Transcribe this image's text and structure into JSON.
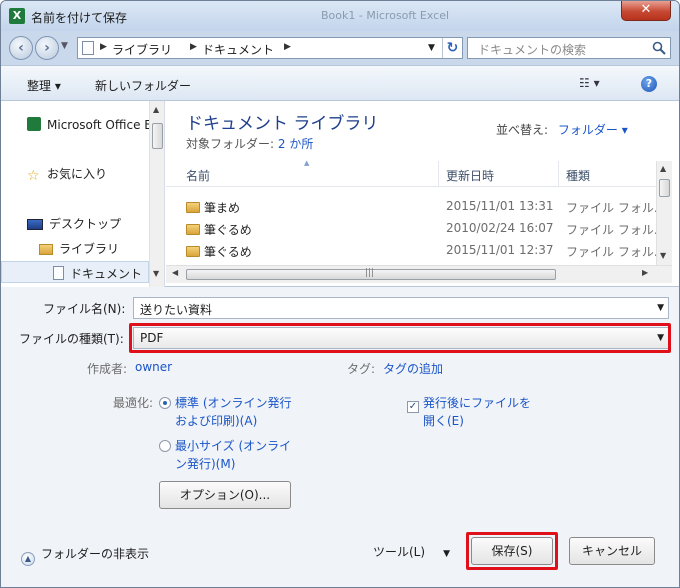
{
  "window": {
    "title": "名前を付けて保存",
    "background_title": "Book1 - Microsoft Excel",
    "close_label": "✕"
  },
  "nav": {
    "breadcrumb": [
      "ライブラリ",
      "ドキュメント"
    ],
    "search_placeholder": "ドキュメントの検索"
  },
  "toolbar": {
    "organize_label": "整理 ▾",
    "new_folder_label": "新しいフォルダー"
  },
  "navpane": {
    "items": [
      {
        "label": "Microsoft Office E",
        "icon": "excel-icon"
      },
      {
        "label": "お気に入り",
        "icon": "star-icon"
      },
      {
        "label": "デスクトップ",
        "icon": "desktop-icon"
      },
      {
        "label": "ライブラリ",
        "icon": "library-icon"
      },
      {
        "label": "ドキュメント",
        "icon": "document-icon"
      }
    ]
  },
  "library": {
    "title": "ドキュメント ライブラリ",
    "subtitle_prefix": "対象フォルダー:",
    "subtitle_link": "2 か所",
    "sort_label": "並べ替え:",
    "sort_value": "フォルダー ▾"
  },
  "file_list": {
    "columns": [
      "名前",
      "更新日時",
      "種類"
    ],
    "rows": [
      {
        "name": "筆まめ",
        "date": "2015/11/01 13:31",
        "type": "ファイル フォル..."
      },
      {
        "name": "筆ぐるめ",
        "date": "2010/02/24 16:07",
        "type": "ファイル フォル..."
      },
      {
        "name": "筆ぐるめ",
        "date": "2015/11/01 12:37",
        "type": "ファイル フォル..."
      }
    ]
  },
  "form": {
    "filename_label": "ファイル名(N):",
    "filename_value": "送りたい資料",
    "filetype_label": "ファイルの種類(T):",
    "filetype_value": "PDF",
    "author_label": "作成者:",
    "author_value": "owner",
    "tag_label": "タグ:",
    "tag_value": "タグの追加",
    "optimize_label": "最適化:",
    "radio_standard_line1": "標準 (オンライン発行",
    "radio_standard_line2": "および印刷)(A)",
    "radio_min_line1": "最小サイズ (オンライ",
    "radio_min_line2": "ン発行)(M)",
    "open_after_line1": "発行後にファイルを",
    "open_after_line2": "開く(E)",
    "options_button": "オプション(O)...",
    "hide_folders": "フォルダーの非表示",
    "tools_label": "ツール(L)",
    "save_button": "保存(S)",
    "cancel_button": "キャンセル"
  },
  "colors": {
    "highlight": "#e0101a",
    "link": "#1a55c8",
    "library_title": "#1e3f8a"
  }
}
